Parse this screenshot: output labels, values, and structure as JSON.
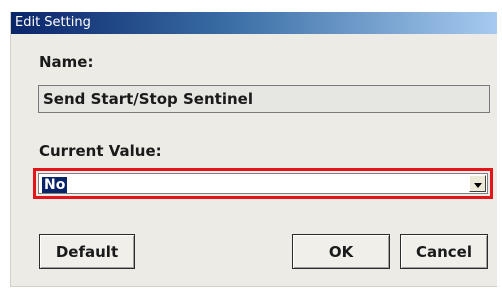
{
  "window": {
    "title": "Edit Setting"
  },
  "name_section": {
    "label": "Name:",
    "value": "Send Start/Stop Sentinel"
  },
  "value_section": {
    "label": "Current Value:",
    "selected": "No"
  },
  "buttons": {
    "default": "Default",
    "ok": "OK",
    "cancel": "Cancel"
  },
  "colors": {
    "highlight_border": "#e3141a",
    "selection_bg": "#0a246a",
    "titlebar": "#0a246a"
  },
  "icons": {
    "dropdown": "chevron-down-icon"
  }
}
